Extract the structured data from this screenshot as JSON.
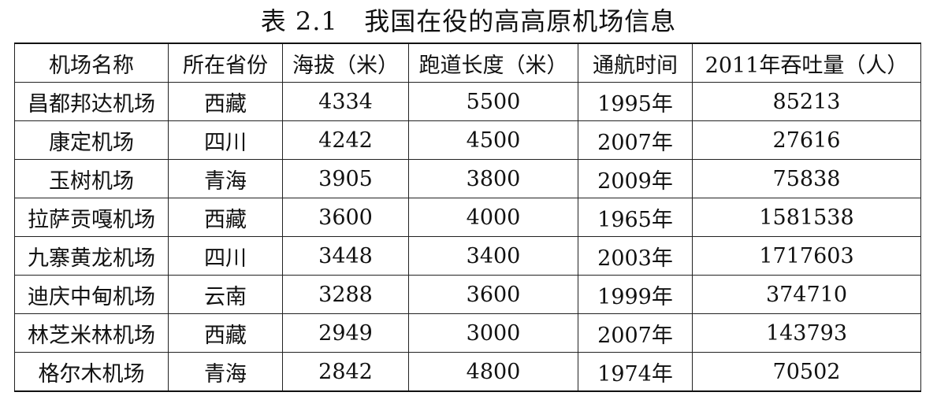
{
  "caption": "表 2.1   我国在役的高高原机场信息",
  "table": {
    "headers": [
      "机场名称",
      "所在省份",
      "海拔（米）",
      "跑道长度（米）",
      "通航时间",
      "2011年吞吐量（人）"
    ],
    "rows": [
      [
        "昌都邦达机场",
        "西藏",
        "4334",
        "5500",
        "1995年",
        "85213"
      ],
      [
        "康定机场",
        "四川",
        "4242",
        "4500",
        "2007年",
        "27616"
      ],
      [
        "玉树机场",
        "青海",
        "3905",
        "3800",
        "2009年",
        "75838"
      ],
      [
        "拉萨贡嘎机场",
        "西藏",
        "3600",
        "4000",
        "1965年",
        "1581538"
      ],
      [
        "九寨黄龙机场",
        "四川",
        "3448",
        "3400",
        "2003年",
        "1717603"
      ],
      [
        "迪庆中甸机场",
        "云南",
        "3288",
        "3600",
        "1999年",
        "374710"
      ],
      [
        "林芝米林机场",
        "西藏",
        "2949",
        "3000",
        "2007年",
        "143793"
      ],
      [
        "格尔木机场",
        "青海",
        "2842",
        "4800",
        "1974年",
        "70502"
      ]
    ]
  }
}
